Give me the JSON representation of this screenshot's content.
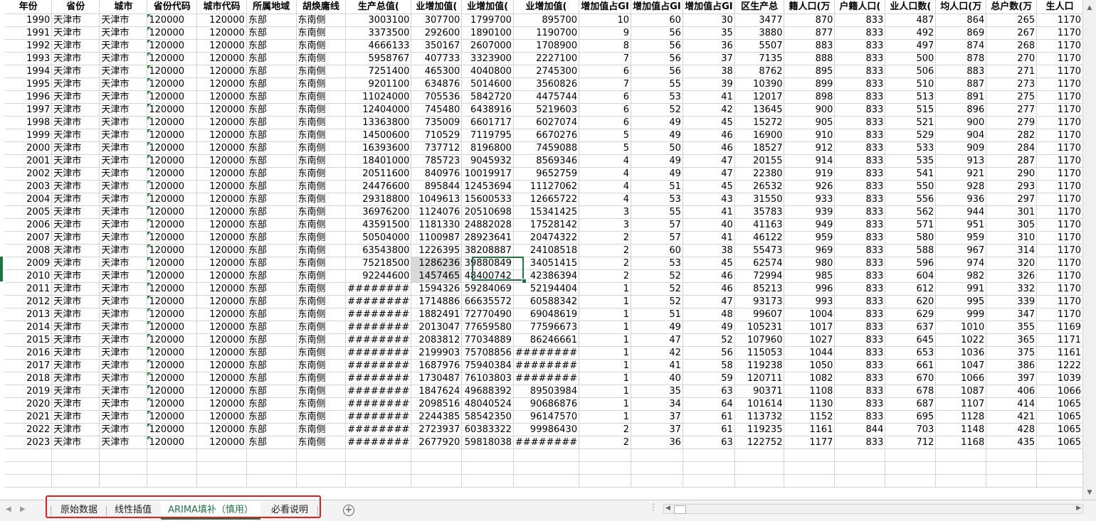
{
  "headers": [
    "年份",
    "省份",
    "城市",
    "省份代码",
    "城市代码",
    "所属地域",
    "胡焕庸线",
    "生产总值(",
    "业增加值(",
    "业增加值(",
    "业增加值(",
    "增加值占GI",
    "增加值占GI",
    "增加值占GI",
    "区生产总",
    "籍人口(万",
    "户籍人口(",
    "业人口数(",
    "均人口(万",
    "总户数(万",
    "生人口"
  ],
  "rows": [
    [
      "1990",
      "天津市",
      "天津市",
      "120000",
      "120000",
      "东部",
      "东南侧",
      "3003100",
      "307700",
      "1799700",
      "895700",
      "10",
      "60",
      "30",
      "3477",
      "870",
      "833",
      "487",
      "864",
      "265",
      "1170"
    ],
    [
      "1991",
      "天津市",
      "天津市",
      "120000",
      "120000",
      "东部",
      "东南侧",
      "3373500",
      "292600",
      "1890100",
      "1190700",
      "9",
      "56",
      "35",
      "3880",
      "877",
      "833",
      "492",
      "869",
      "267",
      "1170"
    ],
    [
      "1992",
      "天津市",
      "天津市",
      "120000",
      "120000",
      "东部",
      "东南侧",
      "4666133",
      "350167",
      "2607000",
      "1708900",
      "8",
      "56",
      "36",
      "5507",
      "883",
      "833",
      "497",
      "874",
      "268",
      "1170"
    ],
    [
      "1993",
      "天津市",
      "天津市",
      "120000",
      "120000",
      "东部",
      "东南侧",
      "5958767",
      "407733",
      "3323900",
      "2227100",
      "7",
      "56",
      "37",
      "7135",
      "888",
      "833",
      "500",
      "878",
      "270",
      "1170"
    ],
    [
      "1994",
      "天津市",
      "天津市",
      "120000",
      "120000",
      "东部",
      "东南侧",
      "7251400",
      "465300",
      "4040800",
      "2745300",
      "6",
      "56",
      "38",
      "8762",
      "895",
      "833",
      "506",
      "883",
      "271",
      "1170"
    ],
    [
      "1995",
      "天津市",
      "天津市",
      "120000",
      "120000",
      "东部",
      "东南侧",
      "9201100",
      "634876",
      "5014600",
      "3560826",
      "7",
      "55",
      "39",
      "10390",
      "899",
      "833",
      "510",
      "887",
      "273",
      "1170"
    ],
    [
      "1996",
      "天津市",
      "天津市",
      "120000",
      "120000",
      "东部",
      "东南侧",
      "11024000",
      "705536",
      "5842720",
      "4475744",
      "6",
      "53",
      "41",
      "12017",
      "898",
      "833",
      "513",
      "891",
      "275",
      "1170"
    ],
    [
      "1997",
      "天津市",
      "天津市",
      "120000",
      "120000",
      "东部",
      "东南侧",
      "12404000",
      "745480",
      "6438916",
      "5219603",
      "6",
      "52",
      "42",
      "13645",
      "900",
      "833",
      "515",
      "896",
      "277",
      "1170"
    ],
    [
      "1998",
      "天津市",
      "天津市",
      "120000",
      "120000",
      "东部",
      "东南侧",
      "13363800",
      "735009",
      "6601717",
      "6027074",
      "6",
      "49",
      "45",
      "15272",
      "905",
      "833",
      "521",
      "900",
      "279",
      "1170"
    ],
    [
      "1999",
      "天津市",
      "天津市",
      "120000",
      "120000",
      "东部",
      "东南侧",
      "14500600",
      "710529",
      "7119795",
      "6670276",
      "5",
      "49",
      "46",
      "16900",
      "910",
      "833",
      "529",
      "904",
      "282",
      "1170"
    ],
    [
      "2000",
      "天津市",
      "天津市",
      "120000",
      "120000",
      "东部",
      "东南侧",
      "16393600",
      "737712",
      "8196800",
      "7459088",
      "5",
      "50",
      "46",
      "18527",
      "912",
      "833",
      "533",
      "909",
      "284",
      "1170"
    ],
    [
      "2001",
      "天津市",
      "天津市",
      "120000",
      "120000",
      "东部",
      "东南侧",
      "18401000",
      "785723",
      "9045932",
      "8569346",
      "4",
      "49",
      "47",
      "20155",
      "914",
      "833",
      "535",
      "913",
      "287",
      "1170"
    ],
    [
      "2002",
      "天津市",
      "天津市",
      "120000",
      "120000",
      "东部",
      "东南侧",
      "20511600",
      "840976",
      "10019917",
      "9652759",
      "4",
      "49",
      "47",
      "22380",
      "919",
      "833",
      "541",
      "921",
      "290",
      "1170"
    ],
    [
      "2003",
      "天津市",
      "天津市",
      "120000",
      "120000",
      "东部",
      "东南侧",
      "24476600",
      "895844",
      "12453694",
      "11127062",
      "4",
      "51",
      "45",
      "26532",
      "926",
      "833",
      "550",
      "928",
      "293",
      "1170"
    ],
    [
      "2004",
      "天津市",
      "天津市",
      "120000",
      "120000",
      "东部",
      "东南侧",
      "29318800",
      "1049613",
      "15600533",
      "12665722",
      "4",
      "53",
      "43",
      "31550",
      "933",
      "833",
      "556",
      "936",
      "297",
      "1170"
    ],
    [
      "2005",
      "天津市",
      "天津市",
      "120000",
      "120000",
      "东部",
      "东南侧",
      "36976200",
      "1124076",
      "20510698",
      "15341425",
      "3",
      "55",
      "41",
      "35783",
      "939",
      "833",
      "562",
      "944",
      "301",
      "1170"
    ],
    [
      "2006",
      "天津市",
      "天津市",
      "120000",
      "120000",
      "东部",
      "东南侧",
      "43591500",
      "1181330",
      "24882028",
      "17528142",
      "3",
      "57",
      "40",
      "41163",
      "949",
      "833",
      "571",
      "951",
      "305",
      "1170"
    ],
    [
      "2007",
      "天津市",
      "天津市",
      "120000",
      "120000",
      "东部",
      "东南侧",
      "50504000",
      "1100987",
      "28923641",
      "20474322",
      "2",
      "57",
      "41",
      "46122",
      "959",
      "833",
      "580",
      "959",
      "310",
      "1170"
    ],
    [
      "2008",
      "天津市",
      "天津市",
      "120000",
      "120000",
      "东部",
      "东南侧",
      "63543800",
      "1226395",
      "38208887",
      "24108518",
      "2",
      "60",
      "38",
      "55473",
      "969",
      "833",
      "588",
      "967",
      "314",
      "1170"
    ],
    [
      "2009",
      "天津市",
      "天津市",
      "120000",
      "120000",
      "东部",
      "东南侧",
      "75218500",
      "1286236",
      "39880849",
      "34051415",
      "2",
      "53",
      "45",
      "62574",
      "980",
      "833",
      "596",
      "974",
      "320",
      "1170"
    ],
    [
      "2010",
      "天津市",
      "天津市",
      "120000",
      "120000",
      "东部",
      "东南侧",
      "92244600",
      "1457465",
      "48400742",
      "42386394",
      "2",
      "52",
      "46",
      "72994",
      "985",
      "833",
      "604",
      "982",
      "326",
      "1170"
    ],
    [
      "2011",
      "天津市",
      "天津市",
      "120000",
      "120000",
      "东部",
      "东南侧",
      "########",
      "1594326",
      "59284069",
      "52194404",
      "1",
      "52",
      "46",
      "85213",
      "996",
      "833",
      "612",
      "991",
      "332",
      "1170"
    ],
    [
      "2012",
      "天津市",
      "天津市",
      "120000",
      "120000",
      "东部",
      "东南侧",
      "########",
      "1714886",
      "66635572",
      "60588342",
      "1",
      "52",
      "47",
      "93173",
      "993",
      "833",
      "620",
      "995",
      "339",
      "1170"
    ],
    [
      "2013",
      "天津市",
      "天津市",
      "120000",
      "120000",
      "东部",
      "东南侧",
      "########",
      "1882491",
      "72770490",
      "69048619",
      "1",
      "51",
      "48",
      "99607",
      "1004",
      "833",
      "629",
      "999",
      "347",
      "1170"
    ],
    [
      "2014",
      "天津市",
      "天津市",
      "120000",
      "120000",
      "东部",
      "东南侧",
      "########",
      "2013047",
      "77659580",
      "77596673",
      "1",
      "49",
      "49",
      "105231",
      "1017",
      "833",
      "637",
      "1010",
      "355",
      "1169"
    ],
    [
      "2015",
      "天津市",
      "天津市",
      "120000",
      "120000",
      "东部",
      "东南侧",
      "########",
      "2083812",
      "77034889",
      "86246661",
      "1",
      "47",
      "52",
      "107960",
      "1027",
      "833",
      "645",
      "1022",
      "365",
      "1171"
    ],
    [
      "2016",
      "天津市",
      "天津市",
      "120000",
      "120000",
      "东部",
      "东南侧",
      "########",
      "2199903",
      "75708856",
      "########",
      "1",
      "42",
      "56",
      "115053",
      "1044",
      "833",
      "653",
      "1036",
      "375",
      "1161"
    ],
    [
      "2017",
      "天津市",
      "天津市",
      "120000",
      "120000",
      "东部",
      "东南侧",
      "########",
      "1687976",
      "75940384",
      "########",
      "1",
      "41",
      "58",
      "119238",
      "1050",
      "833",
      "661",
      "1047",
      "386",
      "1222"
    ],
    [
      "2018",
      "天津市",
      "天津市",
      "120000",
      "120000",
      "东部",
      "东南侧",
      "########",
      "1730487",
      "76103803",
      "########",
      "1",
      "40",
      "59",
      "120711",
      "1082",
      "833",
      "670",
      "1066",
      "397",
      "1039"
    ],
    [
      "2019",
      "天津市",
      "天津市",
      "120000",
      "120000",
      "东部",
      "东南侧",
      "########",
      "1847624",
      "49688392",
      "89503984",
      "1",
      "35",
      "63",
      "90371",
      "1108",
      "833",
      "678",
      "1087",
      "406",
      "1066"
    ],
    [
      "2020",
      "天津市",
      "天津市",
      "120000",
      "120000",
      "东部",
      "东南侧",
      "########",
      "2098516",
      "48040524",
      "90686876",
      "1",
      "34",
      "64",
      "101614",
      "1130",
      "833",
      "687",
      "1107",
      "414",
      "1065"
    ],
    [
      "2021",
      "天津市",
      "天津市",
      "120000",
      "120000",
      "东部",
      "东南侧",
      "########",
      "2244385",
      "58542350",
      "96147570",
      "1",
      "37",
      "61",
      "113732",
      "1152",
      "833",
      "695",
      "1128",
      "421",
      "1065"
    ],
    [
      "2022",
      "天津市",
      "天津市",
      "120000",
      "120000",
      "东部",
      "东南侧",
      "########",
      "2723937",
      "60383322",
      "99986430",
      "2",
      "37",
      "61",
      "119235",
      "1161",
      "844",
      "703",
      "1148",
      "428",
      "1065"
    ],
    [
      "2023",
      "天津市",
      "天津市",
      "120000",
      "120000",
      "东部",
      "东南侧",
      "########",
      "2677920",
      "59818038",
      "########",
      "2",
      "36",
      "63",
      "122752",
      "1177",
      "833",
      "712",
      "1168",
      "435",
      "1065"
    ]
  ],
  "selected_cells": [
    "39880849",
    "48400742"
  ],
  "tabs": [
    {
      "label": "原始数据",
      "active": false
    },
    {
      "label": "线性插值",
      "active": false
    },
    {
      "label": "ARIMA填补（慎用）",
      "active": true
    },
    {
      "label": "必看说明",
      "active": false
    }
  ],
  "colors": {
    "accent": "#217346",
    "highlight_outline": "#e02020",
    "grid": "#d4d4d4"
  }
}
